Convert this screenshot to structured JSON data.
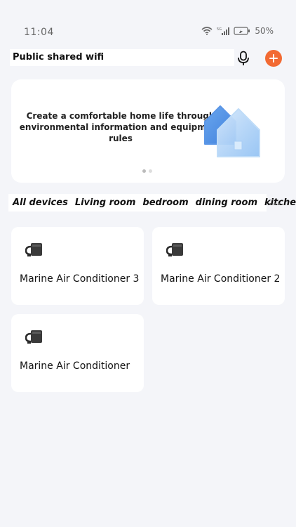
{
  "status": {
    "time": "11:04",
    "battery": "50%"
  },
  "header": {
    "title": "Public shared wifi"
  },
  "banner": {
    "text": "Create a comfortable home life through environmental information and equipment rules"
  },
  "tabs": [
    {
      "label": "All devices"
    },
    {
      "label": "Living room"
    },
    {
      "label": "bedroom"
    },
    {
      "label": "dining room"
    },
    {
      "label": "kitchen"
    }
  ],
  "devices": [
    {
      "name": "Marine Air Conditioner 3",
      "icon": "air-conditioner-icon"
    },
    {
      "name": "Marine Air Conditioner 2",
      "icon": "air-conditioner-icon"
    },
    {
      "name": "Marine Air Conditioner",
      "icon": "air-conditioner-icon"
    }
  ],
  "colors": {
    "accent": "#f26a33",
    "background": "#f4f5f9",
    "card": "#ffffff"
  }
}
